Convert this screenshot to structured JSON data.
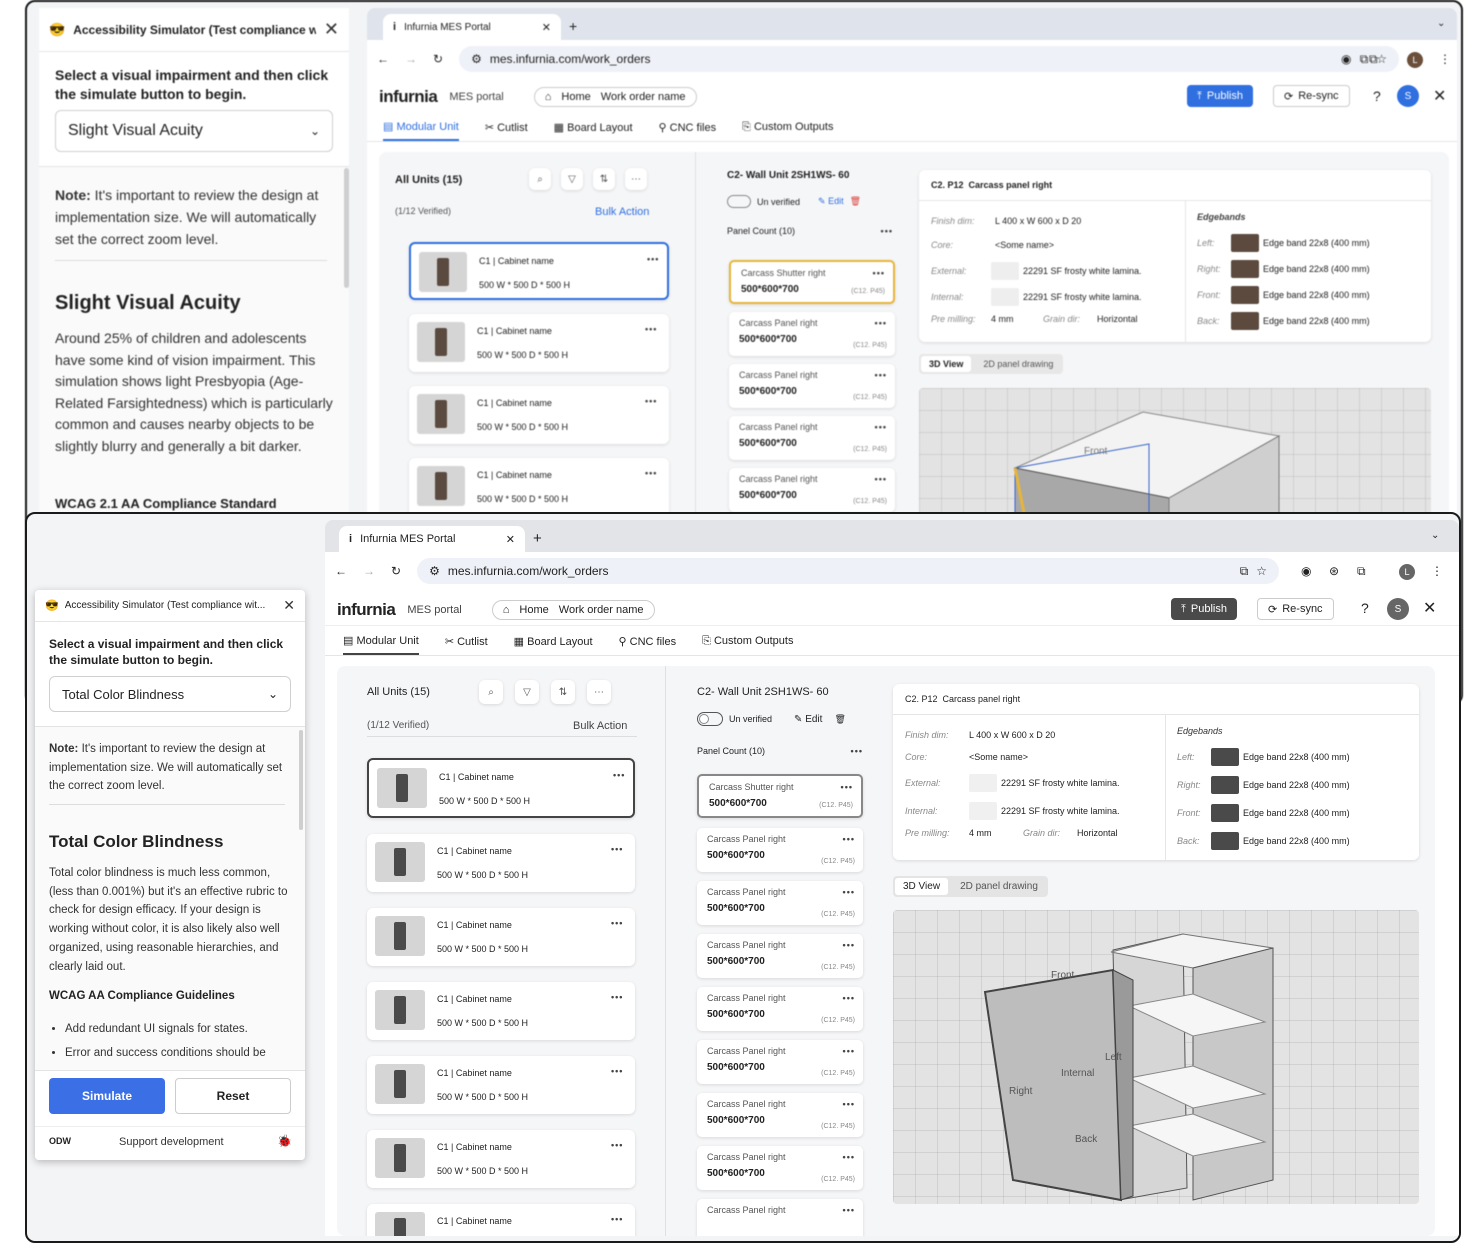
{
  "browser": {
    "tab_title": "Infurnia MES Portal",
    "url": "mes.infurnia.com/work_orders",
    "profile_initial": "L"
  },
  "app": {
    "logo": "infurnia",
    "portal_label": "MES portal",
    "breadcrumb": [
      "Home",
      "Work order name"
    ],
    "publish_label": "Publish",
    "resync_label": "Re-sync",
    "help_label": "?",
    "user_initial": "S",
    "tabs": [
      "Modular Unit",
      "Cutlist",
      "Board Layout",
      "CNC files",
      "Custom Outputs"
    ]
  },
  "units": {
    "title": "All Units (15)",
    "verified": "(1/12 Verified)",
    "bulk_action": "Bulk Action",
    "item_name": "C1 | Cabinet name",
    "item_dims": "500 W * 500 D * 500 H"
  },
  "wall_unit": {
    "title": "C2- Wall Unit 2SH1WS- 60",
    "unverified": "Un verified",
    "edit": "Edit",
    "panel_count": "Panel Count (10)",
    "first_panel": "Carcass Shutter right",
    "panel_name": "Carcass Panel right",
    "panel_dims": "500*600*700",
    "panel_code": "(C12. P45)"
  },
  "details": {
    "code": "C2. P12",
    "name": "Carcass panel right",
    "finish_label": "Finish dim:",
    "finish_value": "L 400 x W 600 x D 20",
    "core_label": "Core:",
    "core_value": "<Some name>",
    "external_label": "External:",
    "external_value": "22291 SF frosty white lamina.",
    "internal_label": "Internal:",
    "internal_value": "22291 SF frosty white lamina.",
    "premill_label": "Pre milling:",
    "premill_value": "4 mm",
    "grain_label": "Grain dir:",
    "grain_value": "Horizontal",
    "edgebands_title": "Edgebands",
    "left_label": "Left:",
    "right_label": "Right:",
    "front_label": "Front:",
    "back_label": "Back:",
    "edge_value": "Edge band 22x8 (400 mm)",
    "view_3d": "3D View",
    "view_2d": "2D panel drawing",
    "label_front": "Front",
    "label_left": "Left",
    "label_internal": "Internal",
    "label_right": "Right",
    "label_back": "Back"
  },
  "sim_top": {
    "header": "Accessibility Simulator (Test compliance wit...",
    "instruction": "Select a visual impairment and then click the simulate button to begin.",
    "selected": "Slight Visual Acuity",
    "note_bold": "Note:",
    "note": "It's important to review the design at implementation size. We will automatically set the correct zoom level.",
    "heading": "Slight Visual Acuity",
    "body": "Around 25% of children and adolescents have some kind of vision impairment. This simulation shows light Presbyopia (Age-Related Farsightedness) which is particularly common and causes nearby objects to be slightly blurry and generally a bit darker.",
    "standard": "WCAG 2.1 AA Compliance Standard"
  },
  "sim_bottom": {
    "header": "Accessibility Simulator (Test compliance wit...",
    "instruction": "Select a visual impairment and then click the simulate button to begin.",
    "selected": "Total Color Blindness",
    "note_bold": "Note:",
    "note": "It's important to review the design at implementation size. We will automatically set the correct zoom level.",
    "heading": "Total Color Blindness",
    "body": "Total color blindness is much less common, (less than 0.001%) but it's an effective rubric to check for design efficacy. If your design is working without color, it is also likely also well organized, using reasonable hierarchies, and clearly laid out.",
    "guidelines_title": "WCAG AA Compliance Guidelines",
    "guidelines": [
      "Add redundant UI signals for states.",
      "Error and success conditions should be"
    ],
    "simulate": "Simulate",
    "reset": "Reset",
    "brand": "ODW",
    "support": "Support development"
  },
  "colors": {
    "accent_blue": "#2f6fe0",
    "publish_gray": "#4a4a4a",
    "simulate_blue": "#3b6fe6",
    "yellow_highlight": "#e8b53a",
    "delete_red": "#d9413c",
    "edge_swatch_brown": "#5c4a3e"
  }
}
